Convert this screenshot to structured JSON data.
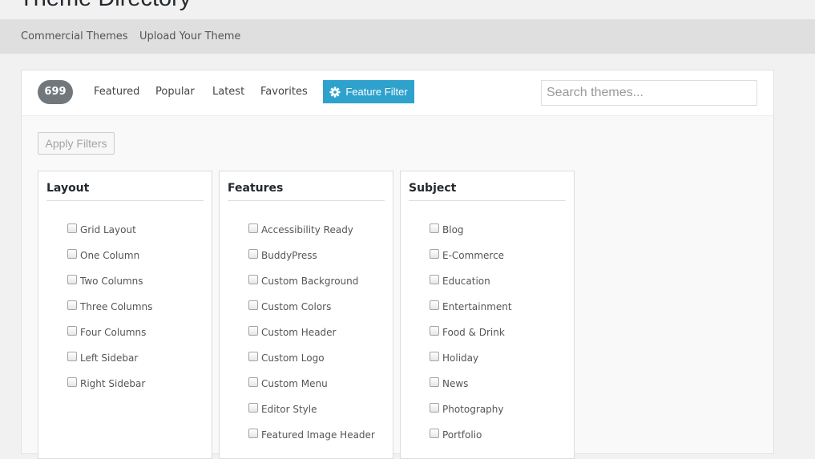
{
  "header": {
    "title": "Theme Directory"
  },
  "subnav": {
    "items": [
      "Commercial Themes",
      "Upload Your Theme"
    ]
  },
  "filter_bar": {
    "count": "699",
    "links": [
      "Featured",
      "Popular",
      "Latest",
      "Favorites"
    ],
    "feature_filter_label": "Feature Filter",
    "search_placeholder": "Search themes..."
  },
  "apply_label": "Apply Filters",
  "groups": [
    {
      "title": "Layout",
      "options": [
        "Grid Layout",
        "One Column",
        "Two Columns",
        "Three Columns",
        "Four Columns",
        "Left Sidebar",
        "Right Sidebar"
      ]
    },
    {
      "title": "Features",
      "options": [
        "Accessibility Ready",
        "BuddyPress",
        "Custom Background",
        "Custom Colors",
        "Custom Header",
        "Custom Logo",
        "Custom Menu",
        "Editor Style",
        "Featured Image Header"
      ]
    },
    {
      "title": "Subject",
      "options": [
        "Blog",
        "E-Commerce",
        "Education",
        "Entertainment",
        "Food & Drink",
        "Holiday",
        "News",
        "Photography",
        "Portfolio"
      ]
    }
  ],
  "colors": {
    "accent": "#2ea2cc",
    "badge": "#72777c",
    "subnav_bg": "#dfdfdf"
  }
}
